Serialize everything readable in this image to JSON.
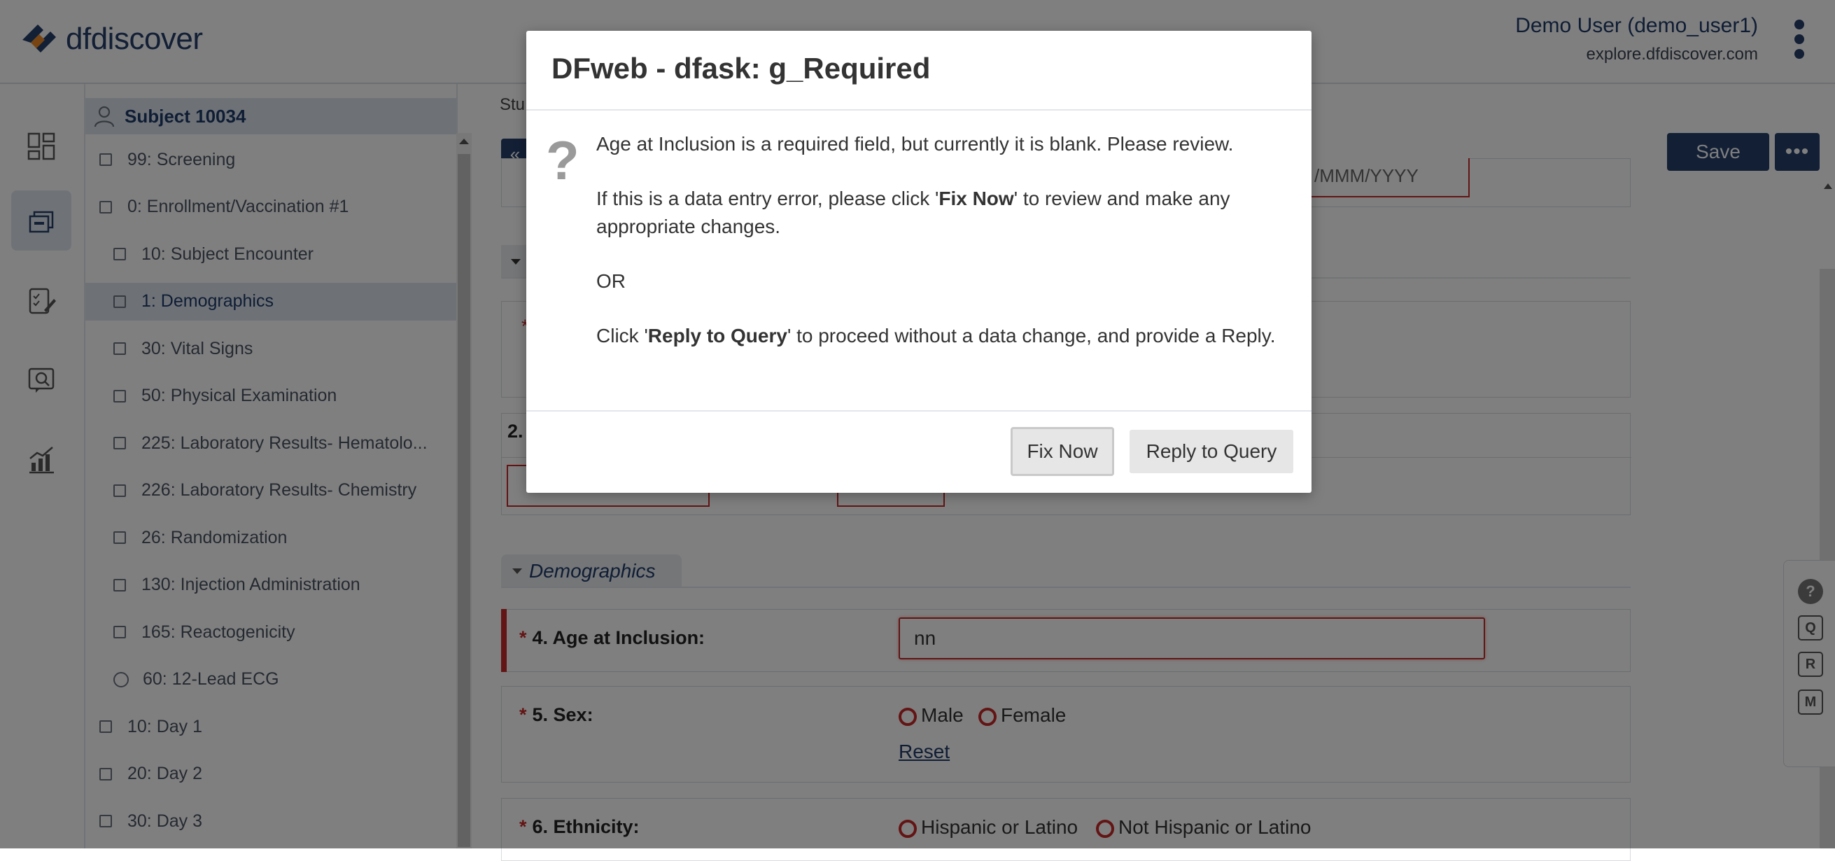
{
  "header": {
    "logo_text": "dfdiscover",
    "user_name": "Demo User (demo_user1)",
    "user_site": "explore.dfdiscover.com"
  },
  "rail": {
    "icons": [
      "dashboard-icon",
      "records-icon",
      "data-entry-icon",
      "queries-icon",
      "reports-icon"
    ],
    "active_index": 1
  },
  "tree": {
    "subject": "Subject 10034",
    "items": [
      {
        "label": "99: Screening",
        "kind": "check",
        "level": 0
      },
      {
        "label": "0: Enrollment/Vaccination #1",
        "kind": "check",
        "level": 0
      },
      {
        "label": "10: Subject Encounter",
        "kind": "check",
        "level": 1
      },
      {
        "label": "1: Demographics",
        "kind": "check",
        "level": 1,
        "selected": true
      },
      {
        "label": "30: Vital Signs",
        "kind": "check",
        "level": 1
      },
      {
        "label": "50: Physical Examination",
        "kind": "check",
        "level": 1
      },
      {
        "label": "225: Laboratory Results- Hematolo...",
        "kind": "check",
        "level": 1
      },
      {
        "label": "226: Laboratory Results- Chemistry",
        "kind": "check",
        "level": 1
      },
      {
        "label": "26: Randomization",
        "kind": "check",
        "level": 1
      },
      {
        "label": "130: Injection Administration",
        "kind": "check",
        "level": 1
      },
      {
        "label": "165: Reactogenicity",
        "kind": "check",
        "level": 1
      },
      {
        "label": "60: 12-Lead ECG",
        "kind": "radio",
        "level": 1
      },
      {
        "label": "10: Day 1",
        "kind": "check",
        "level": 0
      },
      {
        "label": "20: Day 2",
        "kind": "check",
        "level": 0
      },
      {
        "label": "30: Day 3",
        "kind": "check",
        "level": 0
      }
    ]
  },
  "form": {
    "study_label": "Stu",
    "nav_back": "«",
    "save_label": "Save",
    "more_label": "•••",
    "date_hint": "/MMM/YYYY",
    "q2_label": "2.",
    "section_title": "Demographics",
    "q4_label": "4. Age at Inclusion:",
    "q4_value": "nn",
    "q5_label": "5. Sex:",
    "q5_options": [
      "Male",
      "Female"
    ],
    "reset_label": "Reset",
    "q6_label": "6. Ethnicity:",
    "q6_options": [
      "Hispanic or Latino",
      "Not Hispanic or Latino"
    ],
    "required_mark": "*"
  },
  "side_tools": [
    "?",
    "Q",
    "R",
    "M"
  ],
  "modal": {
    "title": "DFweb - dfask: g_Required",
    "icon": "?",
    "line1": "Age at Inclusion is a required field, but currently it is blank. Please review.",
    "line2_pre": "If this is a data entry error, please click '",
    "line2_bold": "Fix Now",
    "line2_post": "' to review and make any appropriate changes.",
    "line3": "OR",
    "line4_pre": "Click '",
    "line4_bold": "Reply to Query",
    "line4_post": "' to proceed without a data change, and provide a Reply.",
    "fix_label": "Fix Now",
    "reply_label": "Reply to Query"
  }
}
